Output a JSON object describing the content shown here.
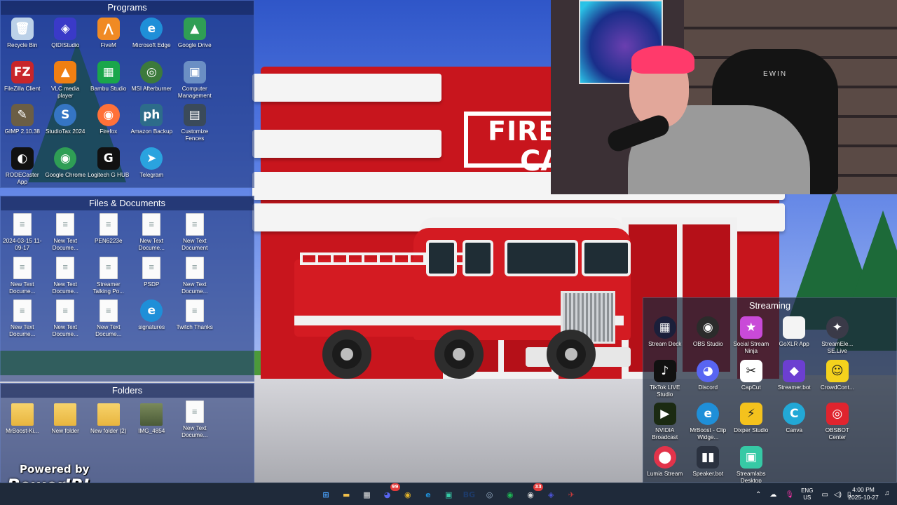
{
  "fences": {
    "programs": {
      "title": "Programs",
      "items": [
        {
          "label": "Recycle Bin",
          "icon": "recycle-bin-icon",
          "glyph": "🗑",
          "color": "#bcd1e8",
          "shape": "square"
        },
        {
          "label": "QIDIStudio",
          "icon": "qidistudio-icon",
          "glyph": "◈",
          "color": "#3a3ac8",
          "shape": "square"
        },
        {
          "label": "FiveM",
          "icon": "fivem-icon",
          "glyph": "⋀",
          "color": "#f08a24",
          "shape": "square"
        },
        {
          "label": "Microsoft Edge",
          "icon": "edge-icon",
          "glyph": "e",
          "color": "#1f8fd8",
          "shape": "round"
        },
        {
          "label": "Google Drive",
          "icon": "google-drive-icon",
          "glyph": "▲",
          "color": "#2f9e55",
          "shape": "square"
        },
        {
          "label": "FileZilla Client",
          "icon": "filezilla-icon",
          "glyph": "FZ",
          "color": "#c8252a",
          "shape": "square"
        },
        {
          "label": "VLC media player",
          "icon": "vlc-icon",
          "glyph": "▲",
          "color": "#f07f12",
          "shape": "square"
        },
        {
          "label": "Bambu Studio",
          "icon": "bambu-studio-icon",
          "glyph": "▦",
          "color": "#1aa64b",
          "shape": "square"
        },
        {
          "label": "MSI Afterburner",
          "icon": "msi-afterburner-icon",
          "glyph": "◎",
          "color": "#3c7a3c",
          "shape": "round"
        },
        {
          "label": "Computer Management",
          "icon": "computer-management-icon",
          "glyph": "▣",
          "color": "#6b8fc4",
          "shape": "square"
        },
        {
          "label": "GIMP 2.10.38",
          "icon": "gimp-icon",
          "glyph": "✎",
          "color": "#6b5e45",
          "shape": "square"
        },
        {
          "label": "StudioTax 2024",
          "icon": "studiotax-icon",
          "glyph": "S",
          "color": "#3575c4",
          "shape": "round"
        },
        {
          "label": "Firefox",
          "icon": "firefox-icon",
          "glyph": "◉",
          "color": "#ff7139",
          "shape": "round"
        },
        {
          "label": "Amazon Backup",
          "icon": "amazon-photos-icon",
          "glyph": "ph",
          "color": "#2d6c8a",
          "shape": "square"
        },
        {
          "label": "Customize Fences",
          "icon": "fences-icon",
          "glyph": "▤",
          "color": "#3a4a5a",
          "shape": "square"
        },
        {
          "label": "RODECaster App",
          "icon": "rodecaster-icon",
          "glyph": "◐",
          "color": "#111111",
          "shape": "square"
        },
        {
          "label": "Google Chrome",
          "icon": "chrome-icon",
          "glyph": "◉",
          "color": "#2f9e55",
          "shape": "round"
        },
        {
          "label": "Logitech G HUB",
          "icon": "logitech-ghub-icon",
          "glyph": "G",
          "color": "#111111",
          "shape": "square"
        },
        {
          "label": "Telegram",
          "icon": "telegram-icon",
          "glyph": "➤",
          "color": "#2aa3df",
          "shape": "round"
        }
      ]
    },
    "files": {
      "title": "Files & Documents",
      "items": [
        {
          "label": "2024-03-15 11-09-17",
          "icon": "image-file-icon"
        },
        {
          "label": "New Text Docume...",
          "icon": "text-document-icon"
        },
        {
          "label": "PEN6223e",
          "icon": "text-document-icon"
        },
        {
          "label": "New Text Docume...",
          "icon": "text-document-icon"
        },
        {
          "label": "New Text Document",
          "icon": "text-document-icon"
        },
        {
          "label": "New Text Docume...",
          "icon": "text-document-icon"
        },
        {
          "label": "New Text Docume...",
          "icon": "text-document-icon"
        },
        {
          "label": "Streamer Talking Po...",
          "icon": "text-document-icon"
        },
        {
          "label": "PSDP",
          "icon": "text-document-icon"
        },
        {
          "label": "New Text Docume...",
          "icon": "text-document-icon"
        },
        {
          "label": "New Text Docume...",
          "icon": "text-document-icon"
        },
        {
          "label": "New Text Docume...",
          "icon": "text-document-icon"
        },
        {
          "label": "New Text Docume...",
          "icon": "text-document-icon"
        },
        {
          "label": "signatures",
          "icon": "edge-document-icon"
        },
        {
          "label": "Twitch Thanks",
          "icon": "text-document-icon"
        }
      ]
    },
    "folders": {
      "title": "Folders",
      "items": [
        {
          "label": "MrBoost-Ki...",
          "icon": "folder-icon"
        },
        {
          "label": "New folder",
          "icon": "folder-icon"
        },
        {
          "label": "New folder (2)",
          "icon": "folder-icon"
        },
        {
          "label": "IMG_4854",
          "icon": "photo-icon"
        },
        {
          "label": "New Text Docume...",
          "icon": "text-document-icon"
        }
      ]
    },
    "streaming": {
      "title": "Streaming",
      "items": [
        {
          "label": "Stream Deck",
          "icon": "stream-deck-icon",
          "glyph": "▦",
          "color": "#1b1f3a",
          "shape": "round"
        },
        {
          "label": "OBS Studio",
          "icon": "obs-icon",
          "glyph": "◉",
          "color": "#2b2b2b",
          "shape": "round"
        },
        {
          "label": "Social Stream Ninja",
          "icon": "social-stream-ninja-icon",
          "glyph": "★",
          "color": "#c94ad8",
          "shape": "square"
        },
        {
          "label": "GoXLR App",
          "icon": "goxlr-icon",
          "glyph": "",
          "color": "#f4f4f4",
          "shape": "square"
        },
        {
          "label": "StreamEle... SE.Live",
          "icon": "streamelements-icon",
          "glyph": "✦",
          "color": "#3a3a48",
          "shape": "round"
        },
        {
          "label": "TikTok LIVE Studio",
          "icon": "tiktok-icon",
          "glyph": "♪",
          "color": "#111111",
          "shape": "square"
        },
        {
          "label": "Discord",
          "icon": "discord-icon",
          "glyph": "◕",
          "color": "#5865f2",
          "shape": "round"
        },
        {
          "label": "CapCut",
          "icon": "capcut-icon",
          "glyph": "✂",
          "color": "#ffffff",
          "shape": "square"
        },
        {
          "label": "Streamer.bot",
          "icon": "streamerbot-icon",
          "glyph": "◆",
          "color": "#6c3fd1",
          "shape": "square"
        },
        {
          "label": "CrowdCont...",
          "icon": "crowdcontrol-icon",
          "glyph": "☺",
          "color": "#f4d21d",
          "shape": "square"
        },
        {
          "label": "NVIDIA Broadcast",
          "icon": "nvidia-broadcast-icon",
          "glyph": "▶",
          "color": "#1b2a12",
          "shape": "square"
        },
        {
          "label": "MrBoost - Clip Widge...",
          "icon": "edge-icon",
          "glyph": "e",
          "color": "#1f8fd8",
          "shape": "round"
        },
        {
          "label": "Dixper Studio",
          "icon": "dixper-icon",
          "glyph": "⚡",
          "color": "#f4c21d",
          "shape": "square"
        },
        {
          "label": "Canva",
          "icon": "canva-icon",
          "glyph": "C",
          "color": "#22a8d6",
          "shape": "round"
        },
        {
          "label": "OBSBOT Center",
          "icon": "obsbot-icon",
          "glyph": "◎",
          "color": "#e0242e",
          "shape": "square"
        },
        {
          "label": "Lumia Stream",
          "icon": "lumia-stream-icon",
          "glyph": "⬤",
          "color": "#e2334a",
          "shape": "round"
        },
        {
          "label": "Speaker.bot",
          "icon": "speakerbot-icon",
          "glyph": "▮▮",
          "color": "#2b3240",
          "shape": "square"
        },
        {
          "label": "Streamlabs Desktop",
          "icon": "streamlabs-icon",
          "glyph": "▣",
          "color": "#36c9a5",
          "shape": "square"
        }
      ]
    }
  },
  "wallpaper": {
    "sign_line1": "FIRE",
    "sign_line2": "CA"
  },
  "webcam": {
    "chair_brand": "EWIN"
  },
  "overlay": {
    "powered_by": "Powered by",
    "brand": "PowerIRL"
  },
  "taskbar": {
    "apps": [
      {
        "name": "start-button-icon",
        "glyph": "⊞",
        "color": "#4aa3ff"
      },
      {
        "name": "file-explorer-icon",
        "glyph": "▬",
        "color": "#f2c04a"
      },
      {
        "name": "microsoft-store-icon",
        "glyph": "▦",
        "color": "#e6e6e6"
      },
      {
        "name": "discord-taskbar-icon",
        "glyph": "◕",
        "color": "#5865f2",
        "badge": "99"
      },
      {
        "name": "chrome-taskbar-icon",
        "glyph": "◉",
        "color": "#e5b52a"
      },
      {
        "name": "edge-taskbar-icon",
        "glyph": "e",
        "color": "#1f8fd8"
      },
      {
        "name": "streamlabs-taskbar-icon",
        "glyph": "▣",
        "color": "#36c9a5"
      },
      {
        "name": "bg-app-taskbar-icon",
        "glyph": "BG",
        "color": "#1d3b6a"
      },
      {
        "name": "steam-taskbar-icon",
        "glyph": "◎",
        "color": "#9ab0c8"
      },
      {
        "name": "spotify-taskbar-icon",
        "glyph": "◉",
        "color": "#1db954"
      },
      {
        "name": "obs-taskbar-icon",
        "glyph": "◉",
        "color": "#d9d9d9",
        "badge": "33"
      },
      {
        "name": "stream-deck-taskbar-icon",
        "glyph": "◈",
        "color": "#4b53d6"
      },
      {
        "name": "game-taskbar-icon",
        "glyph": "✈",
        "color": "#c23b3b"
      }
    ],
    "language": "ENG",
    "region": "US",
    "time": "4:00 PM",
    "date": "2025-10-27"
  }
}
